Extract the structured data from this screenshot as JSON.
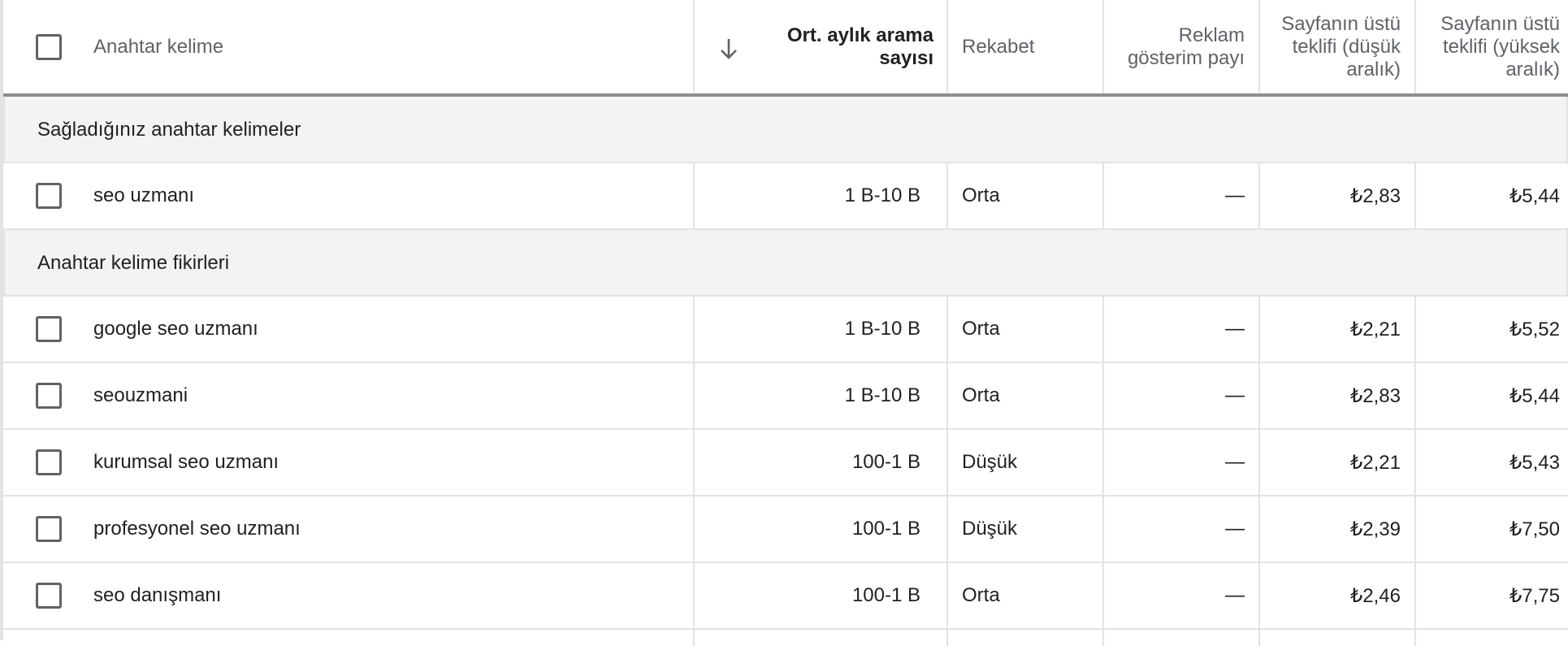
{
  "table": {
    "headers": {
      "keyword": "Anahtar kelime",
      "avg_searches": "Ort. aylık arama sayısı",
      "competition": "Rekabet",
      "impression_share": "Reklam gösterim payı",
      "top_bid_low": "Sayfanın üstü teklifi (düşük aralık)",
      "top_bid_high": "Sayfanın üstü teklifi (yüksek aralık)"
    },
    "groups": [
      {
        "label": "Sağladığınız anahtar kelimeler",
        "rows": [
          {
            "keyword": "seo uzmanı",
            "volume": "1 B-10 B",
            "competition": "Orta",
            "share": "—",
            "low": "₺2,83",
            "high": "₺5,44"
          }
        ]
      },
      {
        "label": "Anahtar kelime fikirleri",
        "rows": [
          {
            "keyword": "google seo uzmanı",
            "volume": "1 B-10 B",
            "competition": "Orta",
            "share": "—",
            "low": "₺2,21",
            "high": "₺5,52"
          },
          {
            "keyword": "seouzmani",
            "volume": "1 B-10 B",
            "competition": "Orta",
            "share": "—",
            "low": "₺2,83",
            "high": "₺5,44"
          },
          {
            "keyword": "kurumsal seo uzmanı",
            "volume": "100-1 B",
            "competition": "Düşük",
            "share": "—",
            "low": "₺2,21",
            "high": "₺5,43"
          },
          {
            "keyword": "profesyonel seo uzmanı",
            "volume": "100-1 B",
            "competition": "Düşük",
            "share": "—",
            "low": "₺2,39",
            "high": "₺7,50"
          },
          {
            "keyword": "seo danışmanı",
            "volume": "100-1 B",
            "competition": "Orta",
            "share": "—",
            "low": "₺2,46",
            "high": "₺7,75"
          }
        ]
      }
    ]
  },
  "icons": {
    "sort": "arrow-down-icon",
    "checkbox": "checkbox-unchecked-icon"
  }
}
